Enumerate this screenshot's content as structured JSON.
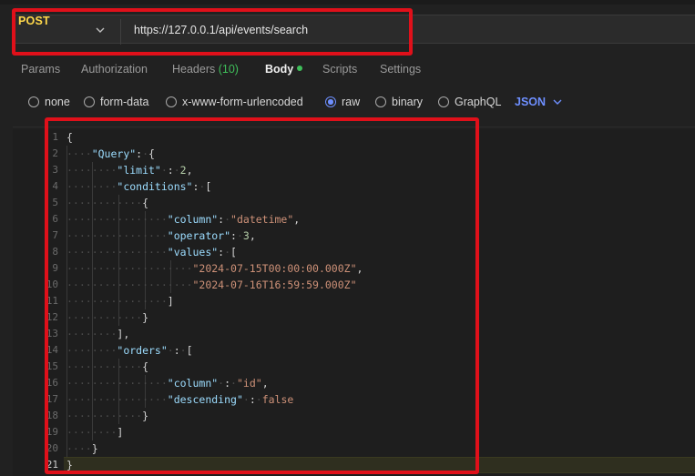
{
  "request": {
    "method": "POST",
    "url": "https://127.0.0.1/api/events/search"
  },
  "tabs": [
    {
      "label": "Params"
    },
    {
      "label": "Authorization"
    },
    {
      "label": "Headers",
      "count": "(10)"
    },
    {
      "label": "Body"
    },
    {
      "label": "Scripts"
    },
    {
      "label": "Settings"
    }
  ],
  "body_types": [
    {
      "label": "none",
      "selected": false
    },
    {
      "label": "form-data",
      "selected": false
    },
    {
      "label": "x-www-form-urlencoded",
      "selected": false
    },
    {
      "label": "raw",
      "selected": true
    },
    {
      "label": "binary",
      "selected": false
    },
    {
      "label": "GraphQL",
      "selected": false
    }
  ],
  "language": "JSON",
  "editor": {
    "current_line": "21",
    "lines": [
      {
        "num": "1"
      },
      {
        "num": "2"
      },
      {
        "num": "3"
      },
      {
        "num": "4"
      },
      {
        "num": "5"
      },
      {
        "num": "6"
      },
      {
        "num": "7"
      },
      {
        "num": "8"
      },
      {
        "num": "9"
      },
      {
        "num": "10"
      },
      {
        "num": "11"
      },
      {
        "num": "12"
      },
      {
        "num": "13"
      },
      {
        "num": "14"
      },
      {
        "num": "15"
      },
      {
        "num": "16"
      },
      {
        "num": "17"
      },
      {
        "num": "18"
      },
      {
        "num": "19"
      },
      {
        "num": "20"
      },
      {
        "num": "21"
      }
    ],
    "json": {
      "query_key": "\"Query\"",
      "limit_key": "\"limit\"",
      "limit_value": "2",
      "conditions_key": "\"conditions\"",
      "column_key": "\"column\"",
      "column_value": "\"datetime\"",
      "operator_key": "\"operator\"",
      "operator_value": "3",
      "values_key": "\"values\"",
      "value_1": "\"2024-07-15T00:00:00.000Z\"",
      "value_2": "\"2024-07-16T16:59:59.000Z\"",
      "orders_key": "\"orders\"",
      "order_column_key": "\"column\"",
      "order_column_value": "\"id\"",
      "descending_key": "\"descending\"",
      "descending_value": "false"
    }
  },
  "colors": {
    "method": "#ffd84a",
    "accent": "#6e8fff",
    "active_dot": "#3fbf5a",
    "highlight_box": "#e0101a"
  }
}
